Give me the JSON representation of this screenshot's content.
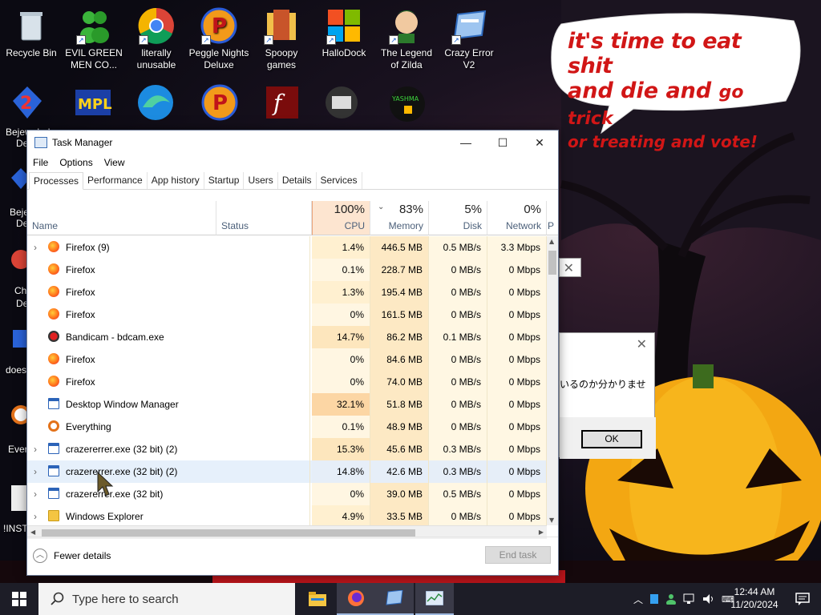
{
  "desktop": {
    "icons_row1": [
      {
        "label": "Recycle Bin",
        "icon": "recycle-bin-icon"
      },
      {
        "label": "EVIL GREEN MEN CO...",
        "icon": "green-men-icon"
      },
      {
        "label": "literally unusable",
        "icon": "chrome-icon"
      },
      {
        "label": "Peggle Nights Deluxe",
        "icon": "peggle-icon"
      },
      {
        "label": "Spoopy games",
        "icon": "folder-icon"
      },
      {
        "label": "HalloDock",
        "icon": "windows-logo-icon"
      },
      {
        "label": "The Legend of Zilda",
        "icon": "zelda-icon"
      },
      {
        "label": "Crazy Error V2",
        "icon": "error-window-icon"
      }
    ],
    "edge_labels": [
      "Bejeweled",
      "Deluxe",
      "Beje",
      "De",
      "Ch",
      "De",
      "does",
      "Ever",
      "!INST"
    ],
    "speech_bubble": {
      "line1": "it's time to eat shit",
      "line2a": "and die and",
      "line2b": "go trick",
      "line3": "or treating and vote!"
    }
  },
  "background_dialog": {
    "text": "いるのか分かりませ",
    "ok_label": "OK"
  },
  "task_manager": {
    "title": "Task Manager",
    "menu": [
      "File",
      "Options",
      "View"
    ],
    "tabs": [
      "Processes",
      "Performance",
      "App history",
      "Startup",
      "Users",
      "Details",
      "Services"
    ],
    "active_tab": "Processes",
    "columns": {
      "name": "Name",
      "status": "Status",
      "cpu": {
        "pct": "100%",
        "label": "CPU"
      },
      "memory": {
        "pct": "83%",
        "label": "Memory"
      },
      "disk": {
        "pct": "5%",
        "label": "Disk"
      },
      "network": {
        "pct": "0%",
        "label": "Network"
      },
      "power": "P"
    },
    "rows": [
      {
        "expand": true,
        "icon": "ff",
        "name": "Firefox (9)",
        "cpu": "1.4%",
        "memory": "446.5 MB",
        "disk": "0.5 MB/s",
        "network": "3.3 Mbps"
      },
      {
        "expand": false,
        "icon": "ff",
        "name": "Firefox",
        "cpu": "0.1%",
        "memory": "228.7 MB",
        "disk": "0 MB/s",
        "network": "0 Mbps"
      },
      {
        "expand": false,
        "icon": "ff",
        "name": "Firefox",
        "cpu": "1.3%",
        "memory": "195.4 MB",
        "disk": "0 MB/s",
        "network": "0 Mbps"
      },
      {
        "expand": false,
        "icon": "ff",
        "name": "Firefox",
        "cpu": "0%",
        "memory": "161.5 MB",
        "disk": "0 MB/s",
        "network": "0 Mbps"
      },
      {
        "expand": false,
        "icon": "bc",
        "name": "Bandicam - bdcam.exe",
        "cpu": "14.7%",
        "memory": "86.2 MB",
        "disk": "0.1 MB/s",
        "network": "0 Mbps"
      },
      {
        "expand": false,
        "icon": "ff",
        "name": "Firefox",
        "cpu": "0%",
        "memory": "84.6 MB",
        "disk": "0 MB/s",
        "network": "0 Mbps"
      },
      {
        "expand": false,
        "icon": "ff",
        "name": "Firefox",
        "cpu": "0%",
        "memory": "74.0 MB",
        "disk": "0 MB/s",
        "network": "0 Mbps"
      },
      {
        "expand": false,
        "icon": "win",
        "name": "Desktop Window Manager",
        "cpu": "32.1%",
        "memory": "51.8 MB",
        "disk": "0 MB/s",
        "network": "0 Mbps"
      },
      {
        "expand": false,
        "icon": "ev",
        "name": "Everything",
        "cpu": "0.1%",
        "memory": "48.9 MB",
        "disk": "0 MB/s",
        "network": "0 Mbps"
      },
      {
        "expand": true,
        "icon": "win",
        "name": "crazererrer.exe (32 bit) (2)",
        "cpu": "15.3%",
        "memory": "45.6 MB",
        "disk": "0.3 MB/s",
        "network": "0 Mbps"
      },
      {
        "expand": true,
        "icon": "win",
        "name": "crazererrer.exe (32 bit) (2)",
        "cpu": "14.8%",
        "memory": "42.6 MB",
        "disk": "0.3 MB/s",
        "network": "0 Mbps",
        "selected": true
      },
      {
        "expand": true,
        "icon": "win",
        "name": "crazererrer.exe (32 bit)",
        "cpu": "0%",
        "memory": "39.0 MB",
        "disk": "0.5 MB/s",
        "network": "0 Mbps"
      },
      {
        "expand": true,
        "icon": "fld",
        "name": "Windows Explorer",
        "cpu": "4.9%",
        "memory": "33.5 MB",
        "disk": "0 MB/s",
        "network": "0 Mbps"
      }
    ],
    "fewer_details": "Fewer details",
    "end_task": "End task"
  },
  "taskbar": {
    "search_placeholder": "Type here to search",
    "apps": [
      "file-explorer-icon",
      "firefox-icon",
      "crazy-error-icon",
      "task-manager-icon"
    ],
    "time": "12:44 AM",
    "date": "11/20/2024"
  }
}
